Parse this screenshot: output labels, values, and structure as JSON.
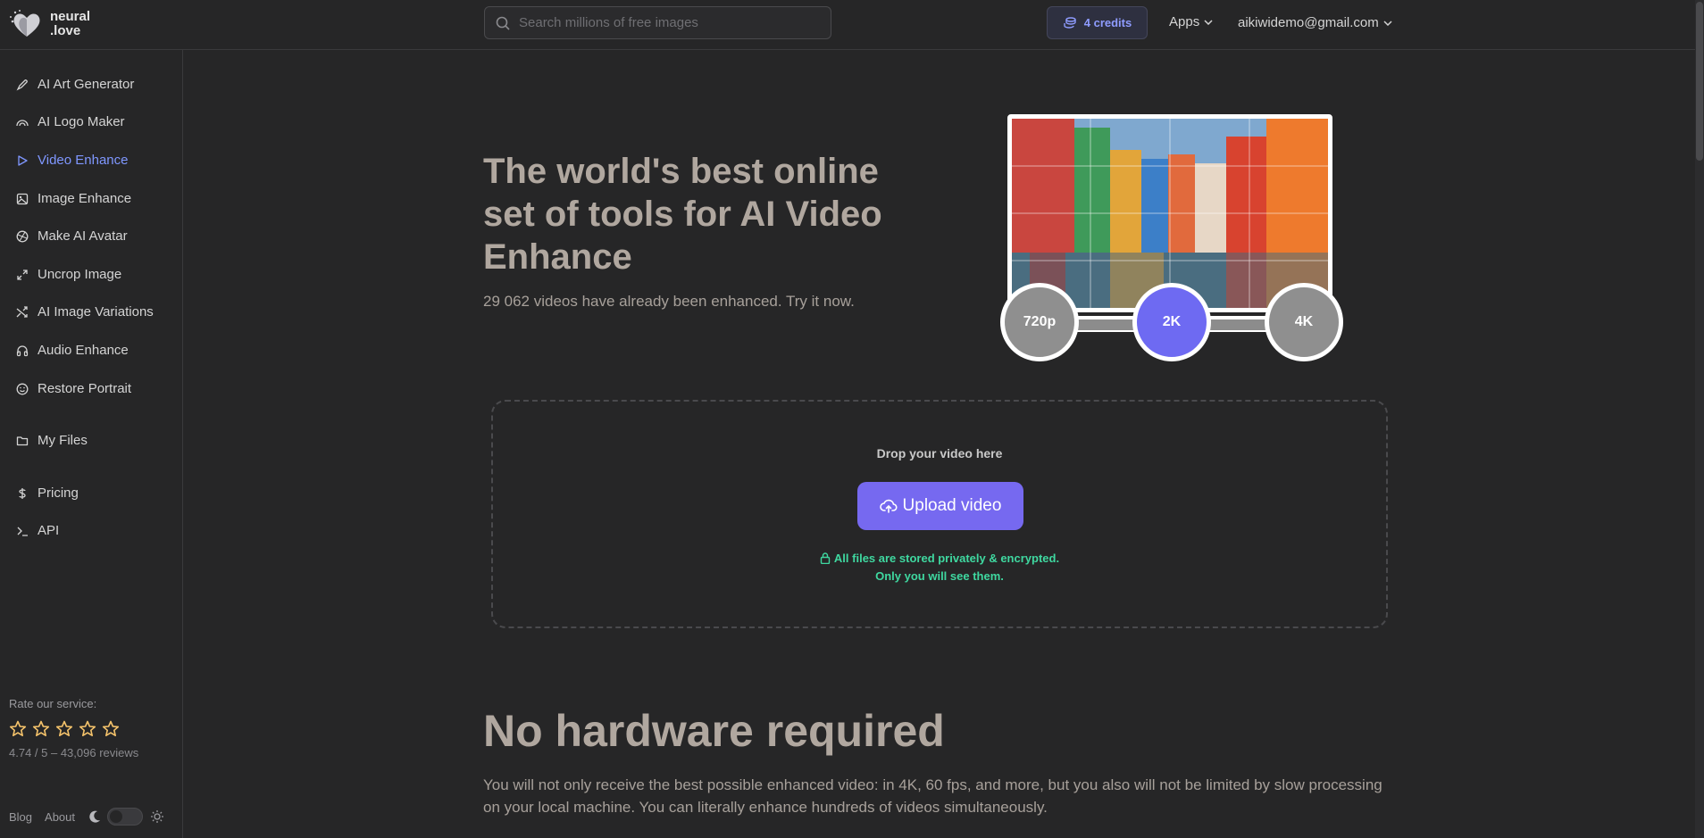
{
  "header": {
    "logo_line1": "neural",
    "logo_line2": ".love",
    "search_placeholder": "Search millions of free images",
    "credits_label": "4 credits",
    "apps_label": "Apps",
    "user_email": "aikiwidemo@gmail.com"
  },
  "sidebar": {
    "items": [
      {
        "label": "AI Art Generator",
        "icon": "brush-icon"
      },
      {
        "label": "AI Logo Maker",
        "icon": "logo-icon"
      },
      {
        "label": "Video Enhance",
        "icon": "play-icon",
        "active": true
      },
      {
        "label": "Image Enhance",
        "icon": "image-icon"
      },
      {
        "label": "Make AI Avatar",
        "icon": "avatar-icon"
      },
      {
        "label": "Uncrop Image",
        "icon": "expand-icon"
      },
      {
        "label": "AI Image Variations",
        "icon": "shuffle-icon"
      },
      {
        "label": "Audio Enhance",
        "icon": "headphones-icon"
      },
      {
        "label": "Restore Portrait",
        "icon": "smile-icon"
      },
      {
        "label": "My Files",
        "icon": "folder-icon"
      },
      {
        "label": "Pricing",
        "icon": "dollar-icon"
      },
      {
        "label": "API",
        "icon": "terminal-icon"
      }
    ],
    "rate_label": "Rate our service:",
    "rate_score": "4.74 / 5 – 43,096 reviews",
    "blog_label": "Blog",
    "about_label": "About"
  },
  "hero": {
    "title": "The world's best online set of tools for AI Video Enhance",
    "subtitle": "29 062 videos have already been enhanced. Try it now.",
    "resolutions": [
      "720p",
      "2K",
      "4K"
    ],
    "active_resolution": "2K"
  },
  "upload": {
    "drop_text": "Drop your video here",
    "button_label": "Upload video",
    "secure_line1": "All files are stored privately & encrypted.",
    "secure_line2": "Only you will see them."
  },
  "section": {
    "heading": "No hardware required",
    "paragraph": "You will not only receive the best possible enhanced video: in 4K, 60 fps, and more, but you also will not be limited by slow processing on your local machine. You can literally enhance hundreds of videos simultaneously."
  },
  "colors": {
    "accent": "#7669f0",
    "active_nav": "#7f97ff",
    "secure_text": "#3fd8a0",
    "star": "#f5c36b"
  }
}
